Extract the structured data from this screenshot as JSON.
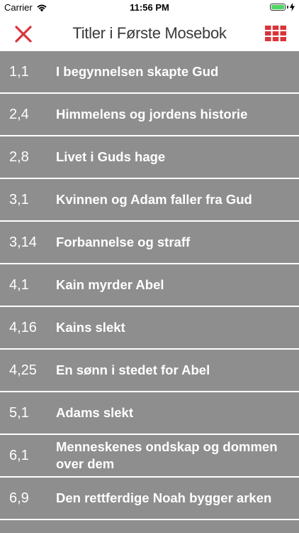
{
  "status_bar": {
    "carrier": "Carrier",
    "time": "11:56 PM",
    "battery_level": 1.0,
    "battery_color": "#4cd964"
  },
  "nav": {
    "title": "Titler i Første Mosebok",
    "close_icon": "close-x-icon",
    "grid_icon": "grid-icon",
    "accent_color": "#d9353a"
  },
  "list": {
    "row_color": "#8e8e8e",
    "items": [
      {
        "ref": "1,1",
        "title": "I begynnelsen skapte Gud"
      },
      {
        "ref": "2,4",
        "title": "Himmelens og jordens historie"
      },
      {
        "ref": "2,8",
        "title": "Livet i Guds hage"
      },
      {
        "ref": "3,1",
        "title": "Kvinnen og Adam faller fra Gud"
      },
      {
        "ref": "3,14",
        "title": "Forbannelse og straff"
      },
      {
        "ref": "4,1",
        "title": "Kain myrder Abel"
      },
      {
        "ref": "4,16",
        "title": "Kains slekt"
      },
      {
        "ref": "4,25",
        "title": "En sønn i stedet for Abel"
      },
      {
        "ref": "5,1",
        "title": "Adams slekt"
      },
      {
        "ref": "6,1",
        "title": "Menneskenes ondskap og dommen over dem"
      },
      {
        "ref": "6,9",
        "title": "Den rettferdige Noah bygger arken"
      }
    ]
  }
}
